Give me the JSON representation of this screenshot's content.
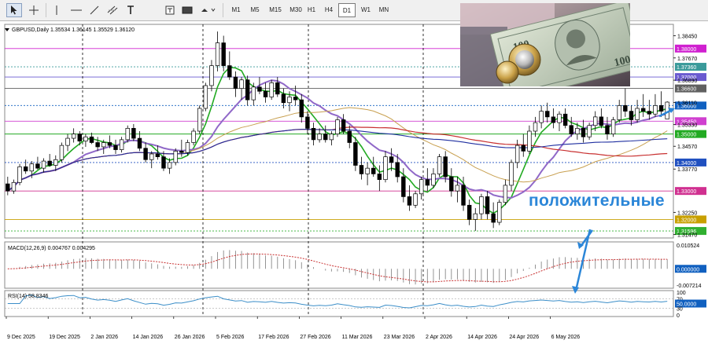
{
  "toolbar": {
    "timeframes": [
      "M1",
      "M5",
      "M15",
      "M30",
      "H1",
      "H4",
      "D1",
      "W1",
      "MN"
    ],
    "active_timeframe": "D1",
    "tools": [
      "cursor-icon",
      "crosshair-icon",
      "vertical-line-icon",
      "horizontal-line-icon",
      "trendline-icon",
      "channel-icon",
      "text-icon",
      "label-icon",
      "shapes-icon",
      "arrow-tools-icon"
    ]
  },
  "chart": {
    "header": "GBPUSD,Daily  1.35534 1.36145 1.35529 1.36120",
    "annotation": "положительные",
    "colors": {
      "bull": "#ffffff",
      "bear": "#000000",
      "ma_fast": "#22aa22",
      "ma_mid": "#9068c8",
      "ma_slow": "#c8a050",
      "ma_red": "#c83030",
      "ma_navy": "#1e2ea0",
      "macd_hist": "#888888",
      "macd_signal": "#c83030",
      "rsi": "#3b8ec8",
      "arrow": "#2b86d8"
    }
  },
  "price_scale": {
    "ticks": [
      "1.38450",
      "1.37670",
      "1.36890",
      "1.36110",
      "1.35330",
      "1.34570",
      "1.33770",
      "1.32250",
      "1.31470"
    ],
    "levels": [
      {
        "value": "1.38000",
        "color": "#d020d0"
      },
      {
        "value": "1.37360",
        "color": "#3a9a9a"
      },
      {
        "value": "1.37000",
        "color": "#6a5ad0"
      },
      {
        "value": "1.36600",
        "color": "#606060"
      },
      {
        "value": "1.36000",
        "color": "#1060c0"
      },
      {
        "value": "1.35450",
        "color": "#d040d0"
      },
      {
        "value": "1.35000",
        "color": "#22aa22"
      },
      {
        "value": "1.34000",
        "color": "#2050c0"
      },
      {
        "value": "1.33000",
        "color": "#d03090"
      },
      {
        "value": "1.32000",
        "color": "#c8a000"
      },
      {
        "value": "1.31596",
        "color": "#30b030"
      }
    ]
  },
  "macd": {
    "label": "MACD(12,26,9) 0.004767 0.004295",
    "ticks": [
      "0.010524",
      "0.000000",
      "-0.007214"
    ]
  },
  "rsi": {
    "label": "RSI(14) 58.8346",
    "ticks": [
      "100",
      "70",
      "50.0000",
      "30",
      "0"
    ]
  },
  "date_axis": [
    "9 Dec 2025",
    "19 Dec 2025",
    "2 Jan 2026",
    "14 Jan 2026",
    "26 Jan 2026",
    "5 Feb 2026",
    "17 Feb 2026",
    "27 Feb 2026",
    "11 Mar 2026",
    "23 Mar 2026",
    "2 Apr 2026",
    "14 Apr 2026",
    "24 Apr 2026",
    "6 May 2026"
  ],
  "chart_data": {
    "type": "candlestick",
    "symbol": "GBPUSD",
    "timeframe": "Daily",
    "ylim": [
      1.3135,
      1.3885
    ],
    "ohlc": [
      [
        1.3325,
        1.335,
        1.3285,
        1.33
      ],
      [
        1.33,
        1.334,
        1.329,
        1.333
      ],
      [
        1.333,
        1.3395,
        1.332,
        1.3385
      ],
      [
        1.3385,
        1.341,
        1.336,
        1.337
      ],
      [
        1.337,
        1.3405,
        1.3345,
        1.3395
      ],
      [
        1.3395,
        1.342,
        1.3375,
        1.338
      ],
      [
        1.338,
        1.3415,
        1.3365,
        1.3405
      ],
      [
        1.3405,
        1.343,
        1.3385,
        1.339
      ],
      [
        1.339,
        1.3425,
        1.337,
        1.341
      ],
      [
        1.341,
        1.347,
        1.34,
        1.346
      ],
      [
        1.346,
        1.35,
        1.344,
        1.3485
      ],
      [
        1.3485,
        1.352,
        1.347,
        1.35
      ],
      [
        1.35,
        1.351,
        1.346,
        1.3475
      ],
      [
        1.3475,
        1.35,
        1.3455,
        1.349
      ],
      [
        1.349,
        1.3505,
        1.3465,
        1.347
      ],
      [
        1.347,
        1.349,
        1.344,
        1.3455
      ],
      [
        1.3455,
        1.348,
        1.343,
        1.347
      ],
      [
        1.347,
        1.3495,
        1.345,
        1.346
      ],
      [
        1.346,
        1.348,
        1.343,
        1.3445
      ],
      [
        1.3445,
        1.349,
        1.3435,
        1.348
      ],
      [
        1.348,
        1.353,
        1.347,
        1.352
      ],
      [
        1.352,
        1.3535,
        1.3475,
        1.3485
      ],
      [
        1.3485,
        1.351,
        1.344,
        1.345
      ],
      [
        1.345,
        1.347,
        1.34,
        1.341
      ],
      [
        1.341,
        1.344,
        1.338,
        1.343
      ],
      [
        1.343,
        1.346,
        1.341,
        1.342
      ],
      [
        1.342,
        1.344,
        1.337,
        1.338
      ],
      [
        1.338,
        1.3415,
        1.336,
        1.34
      ],
      [
        1.34,
        1.345,
        1.339,
        1.344
      ],
      [
        1.344,
        1.348,
        1.342,
        1.3435
      ],
      [
        1.3435,
        1.348,
        1.3425,
        1.347
      ],
      [
        1.347,
        1.352,
        1.346,
        1.351
      ],
      [
        1.351,
        1.36,
        1.35,
        1.359
      ],
      [
        1.359,
        1.368,
        1.358,
        1.367
      ],
      [
        1.367,
        1.376,
        1.365,
        1.374
      ],
      [
        1.374,
        1.386,
        1.372,
        1.382
      ],
      [
        1.382,
        1.3845,
        1.372,
        1.374
      ],
      [
        1.374,
        1.379,
        1.369,
        1.37
      ],
      [
        1.37,
        1.372,
        1.363,
        1.366
      ],
      [
        1.366,
        1.37,
        1.362,
        1.369
      ],
      [
        1.369,
        1.3705,
        1.36,
        1.362
      ],
      [
        1.362,
        1.368,
        1.36,
        1.3665
      ],
      [
        1.3665,
        1.37,
        1.364,
        1.365
      ],
      [
        1.365,
        1.368,
        1.361,
        1.363
      ],
      [
        1.363,
        1.369,
        1.362,
        1.368
      ],
      [
        1.368,
        1.37,
        1.363,
        1.364
      ],
      [
        1.364,
        1.366,
        1.359,
        1.361
      ],
      [
        1.361,
        1.365,
        1.358,
        1.363
      ],
      [
        1.363,
        1.367,
        1.36,
        1.362
      ],
      [
        1.362,
        1.364,
        1.354,
        1.356
      ],
      [
        1.356,
        1.358,
        1.35,
        1.352
      ],
      [
        1.352,
        1.354,
        1.346,
        1.348
      ],
      [
        1.348,
        1.352,
        1.347,
        1.35
      ],
      [
        1.35,
        1.353,
        1.347,
        1.348
      ],
      [
        1.348,
        1.351,
        1.346,
        1.35
      ],
      [
        1.35,
        1.356,
        1.349,
        1.355
      ],
      [
        1.355,
        1.357,
        1.35,
        1.351
      ],
      [
        1.351,
        1.353,
        1.345,
        1.347
      ],
      [
        1.347,
        1.349,
        1.337,
        1.339
      ],
      [
        1.339,
        1.342,
        1.334,
        1.336
      ],
      [
        1.336,
        1.34,
        1.332,
        1.338
      ],
      [
        1.338,
        1.342,
        1.335,
        1.336
      ],
      [
        1.336,
        1.339,
        1.33,
        1.334
      ],
      [
        1.334,
        1.344,
        1.333,
        1.342
      ],
      [
        1.342,
        1.345,
        1.337,
        1.34
      ],
      [
        1.34,
        1.343,
        1.333,
        1.335
      ],
      [
        1.335,
        1.338,
        1.326,
        1.328
      ],
      [
        1.328,
        1.332,
        1.323,
        1.325
      ],
      [
        1.325,
        1.33,
        1.324,
        1.329
      ],
      [
        1.329,
        1.335,
        1.327,
        1.334
      ],
      [
        1.334,
        1.338,
        1.33,
        1.332
      ],
      [
        1.332,
        1.338,
        1.331,
        1.336
      ],
      [
        1.336,
        1.343,
        1.335,
        1.342
      ],
      [
        1.342,
        1.344,
        1.333,
        1.335
      ],
      [
        1.335,
        1.338,
        1.328,
        1.33
      ],
      [
        1.33,
        1.335,
        1.326,
        1.332
      ],
      [
        1.332,
        1.335,
        1.323,
        1.325
      ],
      [
        1.325,
        1.327,
        1.318,
        1.32
      ],
      [
        1.32,
        1.324,
        1.316,
        1.322
      ],
      [
        1.322,
        1.329,
        1.32,
        1.328
      ],
      [
        1.328,
        1.33,
        1.32,
        1.322
      ],
      [
        1.322,
        1.326,
        1.317,
        1.319
      ],
      [
        1.319,
        1.327,
        1.318,
        1.326
      ],
      [
        1.326,
        1.334,
        1.325,
        1.332
      ],
      [
        1.332,
        1.341,
        1.33,
        1.34
      ],
      [
        1.34,
        1.348,
        1.338,
        1.346
      ],
      [
        1.346,
        1.35,
        1.342,
        1.344
      ],
      [
        1.344,
        1.353,
        1.343,
        1.351
      ],
      [
        1.351,
        1.356,
        1.349,
        1.354
      ],
      [
        1.354,
        1.36,
        1.352,
        1.358
      ],
      [
        1.358,
        1.361,
        1.354,
        1.356
      ],
      [
        1.356,
        1.359,
        1.352,
        1.354
      ],
      [
        1.354,
        1.358,
        1.351,
        1.357
      ],
      [
        1.357,
        1.359,
        1.352,
        1.353
      ],
      [
        1.353,
        1.356,
        1.349,
        1.35
      ],
      [
        1.35,
        1.354,
        1.348,
        1.352
      ],
      [
        1.352,
        1.355,
        1.347,
        1.349
      ],
      [
        1.349,
        1.354,
        1.348,
        1.353
      ],
      [
        1.353,
        1.358,
        1.351,
        1.356
      ],
      [
        1.356,
        1.359,
        1.352,
        1.353
      ],
      [
        1.353,
        1.356,
        1.348,
        1.35
      ],
      [
        1.35,
        1.356,
        1.349,
        1.355
      ],
      [
        1.355,
        1.362,
        1.354,
        1.36
      ],
      [
        1.36,
        1.366,
        1.356,
        1.358
      ],
      [
        1.358,
        1.36,
        1.353,
        1.355
      ],
      [
        1.355,
        1.362,
        1.354,
        1.359
      ],
      [
        1.359,
        1.364,
        1.356,
        1.358
      ],
      [
        1.358,
        1.362,
        1.355,
        1.357
      ],
      [
        1.357,
        1.364,
        1.356,
        1.36
      ],
      [
        1.36,
        1.365,
        1.356,
        1.358
      ],
      [
        1.3553,
        1.3615,
        1.3553,
        1.3612
      ]
    ]
  }
}
